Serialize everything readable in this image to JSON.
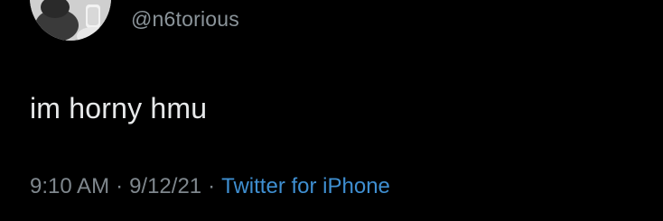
{
  "tweet": {
    "handle": "@n6torious",
    "text": "im horny hmu",
    "time": "9:10 AM",
    "date": "9/12/21",
    "source": "Twitter for iPhone",
    "separator": "·"
  },
  "colors": {
    "background": "#000000",
    "text": "#e7e9ea",
    "muted": "#7f878d",
    "link": "#3f8fd1"
  }
}
